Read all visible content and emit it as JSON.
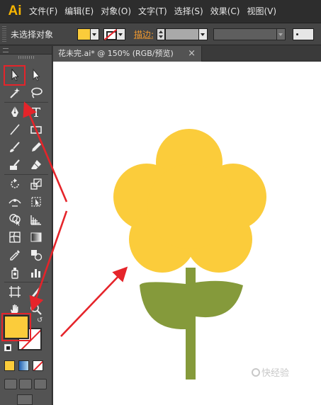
{
  "app": {
    "logo_text": "Ai"
  },
  "menu": [
    "文件(F)",
    "编辑(E)",
    "对象(O)",
    "文字(T)",
    "选择(S)",
    "效果(C)",
    "视图(V)"
  ],
  "control_bar": {
    "selection_status": "未选择对象",
    "fill_color": "#fbcc3b",
    "stroke_label": "描边:"
  },
  "document_tab": {
    "title": "花未完.ai* @ 150% (RGB/预览)",
    "close_glyph": "×"
  },
  "tools": [
    {
      "name": "selection-tool",
      "icon": "arrow-black"
    },
    {
      "name": "direct-selection-tool",
      "icon": "arrow-white"
    },
    {
      "name": "magic-wand-tool",
      "icon": "magic-wand"
    },
    {
      "name": "lasso-tool",
      "icon": "lasso"
    },
    {
      "name": "pen-tool",
      "icon": "pen-nib"
    },
    {
      "name": "type-tool",
      "icon": "letter-t"
    },
    {
      "name": "line-segment-tool",
      "icon": "line"
    },
    {
      "name": "rectangle-tool",
      "icon": "rectangle"
    },
    {
      "name": "paintbrush-tool",
      "icon": "brush"
    },
    {
      "name": "pencil-tool",
      "icon": "pencil"
    },
    {
      "name": "blob-brush-tool",
      "icon": "blob-brush"
    },
    {
      "name": "eraser-tool",
      "icon": "eraser"
    },
    {
      "name": "rotate-tool",
      "icon": "rotate"
    },
    {
      "name": "scale-tool",
      "icon": "scale"
    },
    {
      "name": "width-tool",
      "icon": "width"
    },
    {
      "name": "free-transform-tool",
      "icon": "free-transform"
    },
    {
      "name": "shape-builder-tool",
      "icon": "shape-builder"
    },
    {
      "name": "perspective-grid-tool",
      "icon": "perspective"
    },
    {
      "name": "mesh-tool",
      "icon": "mesh"
    },
    {
      "name": "gradient-tool",
      "icon": "gradient"
    },
    {
      "name": "eyedropper-tool",
      "icon": "eyedropper"
    },
    {
      "name": "blend-tool",
      "icon": "blend"
    },
    {
      "name": "symbol-sprayer-tool",
      "icon": "sprayer"
    },
    {
      "name": "column-graph-tool",
      "icon": "graph"
    },
    {
      "name": "artboard-tool",
      "icon": "artboard"
    },
    {
      "name": "slice-tool",
      "icon": "slice"
    },
    {
      "name": "hand-tool",
      "icon": "hand"
    },
    {
      "name": "zoom-tool",
      "icon": "magnifier"
    }
  ],
  "swatches": {
    "fill": "#fbcc3b",
    "stroke": "none"
  },
  "artwork": {
    "petal_color": "#fbcc3b",
    "stem_color": "#859a3b",
    "leaf_color": "#859a3b",
    "arrow_color": "#e5242a"
  },
  "watermark": {
    "text": "快经验"
  }
}
